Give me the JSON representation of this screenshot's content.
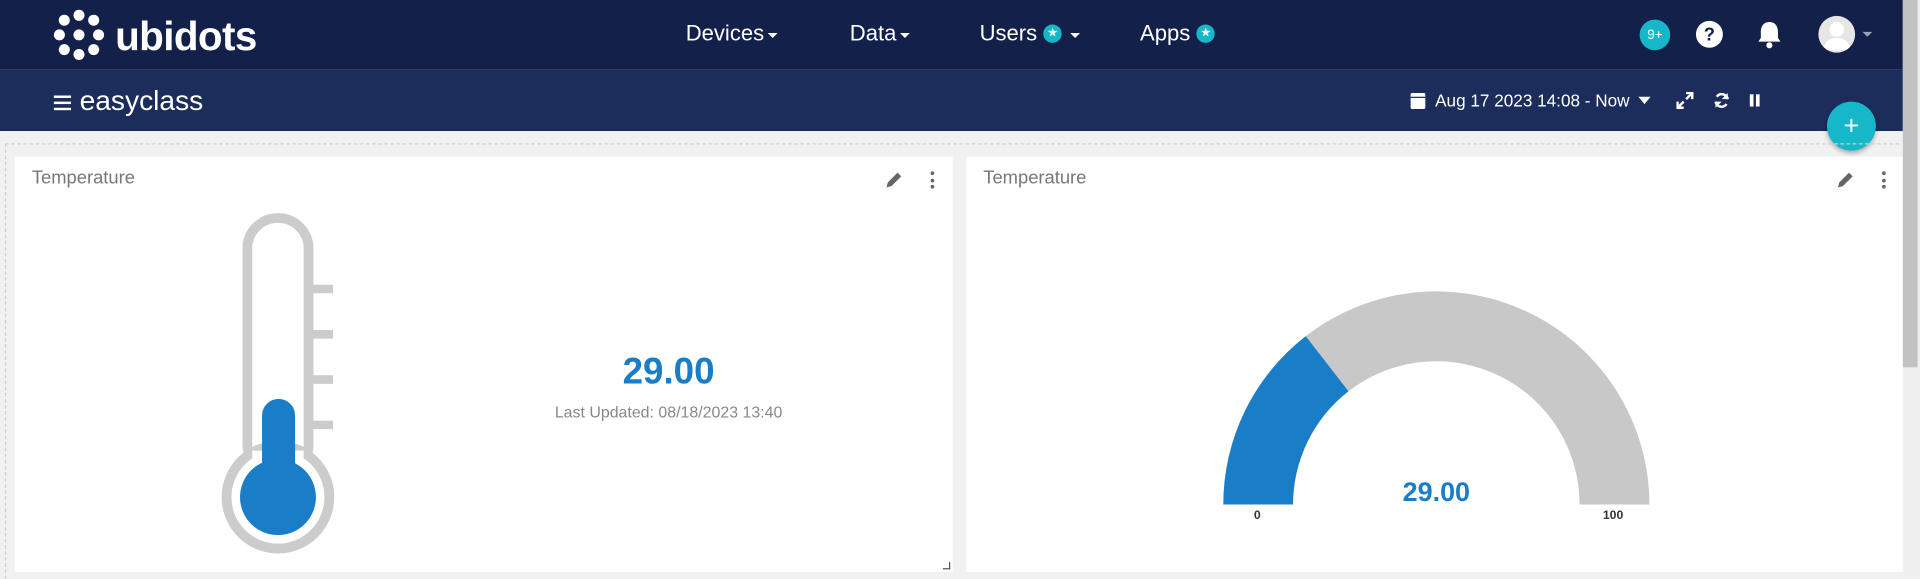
{
  "brand": {
    "name": "ubidots"
  },
  "nav": {
    "devices": "Devices",
    "data": "Data",
    "users": "Users",
    "apps": "Apps"
  },
  "header": {
    "notification_count": "9+",
    "help_label": "?"
  },
  "subbar": {
    "dashboard_name": "easyclass",
    "date_range": "Aug 17 2023 14:08 - Now"
  },
  "fab": {
    "label": "+"
  },
  "widgets": {
    "thermometer": {
      "title": "Temperature",
      "value": "29.00",
      "last_updated": "Last Updated: 08/18/2023 13:40",
      "level": 0.29
    },
    "gauge": {
      "title": "Temperature",
      "value": "29.00",
      "min_label": "0",
      "max_label": "100",
      "fraction": 0.29
    }
  },
  "colors": {
    "accent": "#1a7dc7",
    "navbar": "#13204a",
    "subbar": "#1c2d5b",
    "teal": "#15b7c8",
    "gauge_bg": "#c8c8c8"
  }
}
